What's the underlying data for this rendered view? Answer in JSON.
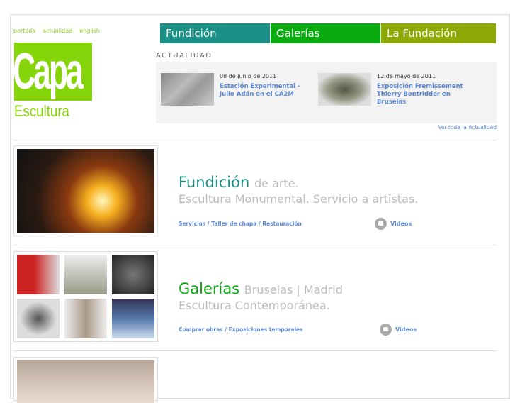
{
  "top_links": [
    "portada",
    "actualidad",
    "english"
  ],
  "logo": {
    "line1": "Capa",
    "line2": "Escultura"
  },
  "nav": [
    {
      "label": "Fundición",
      "color": "#1a8f86"
    },
    {
      "label": "Galerías",
      "color": "#0aab10"
    },
    {
      "label": "La Fundación",
      "color": "#8ea806"
    }
  ],
  "news": {
    "heading": "ACTUALIDAD",
    "items": [
      {
        "date": "08 de junio de 2011",
        "title": "Estación Experimental - Julio Adán en el CA2M"
      },
      {
        "date": "12 de mayo de 2011",
        "title": "Exposición Fremissement Thierry Bontridder en Bruselas"
      }
    ],
    "more": "Ver toda la Actualidad"
  },
  "sections": [
    {
      "title": "Fundición",
      "subtitle": "de arte.",
      "line2": "Escultura Monumental. Servicio a artistas.",
      "links": "Servicios / Taller de chapa / Restauración",
      "videos": "Videos",
      "color": "#1a8f86"
    },
    {
      "title": "Galerías",
      "subtitle": "Bruselas | Madrid",
      "line2": "Escultura Contemporánea.",
      "links": "Comprar obras / Exposiciones temporales",
      "videos": "Videos",
      "color": "#0aab10"
    }
  ]
}
